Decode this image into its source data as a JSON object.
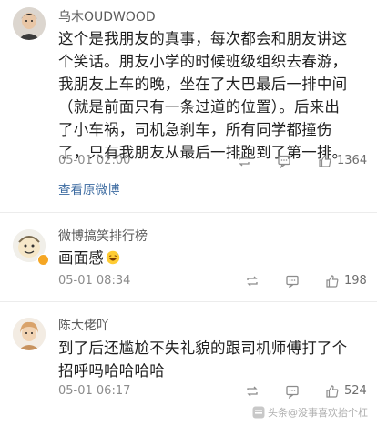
{
  "comments": [
    {
      "username": "乌木OUDWOOD",
      "content_lines": [
        "这个是我朋友的真事，每次都会和朋友讲这",
        "个笑话。朋友小学的时候班级组织去春游，",
        "我朋友上车的晚，坐在了大巴最后一排中间",
        "（就是前面只有一条过道的位置）。后来出",
        "了小车祸，司机急刹车，所有同学都撞伤",
        "了，只有我朋友从最后一排跑到了第一排。"
      ],
      "time": "05-01 02:00",
      "likes": "1364",
      "view_original": "查看原微博",
      "verified": false
    },
    {
      "username": "微博搞笑排行榜",
      "content_lines": [
        "画面感"
      ],
      "emoji": "grin-sweat-emoji",
      "time": "05-01 08:34",
      "likes": "198",
      "verified": true
    },
    {
      "username": "陈大佬吖",
      "content_lines": [
        "到了后还尴尬不失礼貌的跟司机师傅打了个",
        "招呼吗哈哈哈哈"
      ],
      "time": "05-01 06:17",
      "likes": "524",
      "verified": false
    }
  ],
  "icons": {
    "repost": "repost-icon",
    "comment": "comment-icon",
    "like": "thumbs-up-icon"
  },
  "watermark": {
    "text": "头条@没事喜欢抬个杠"
  },
  "colors": {
    "link": "#3b6aa0",
    "badge": "#f5a623",
    "meta": "#8c8c8c"
  }
}
